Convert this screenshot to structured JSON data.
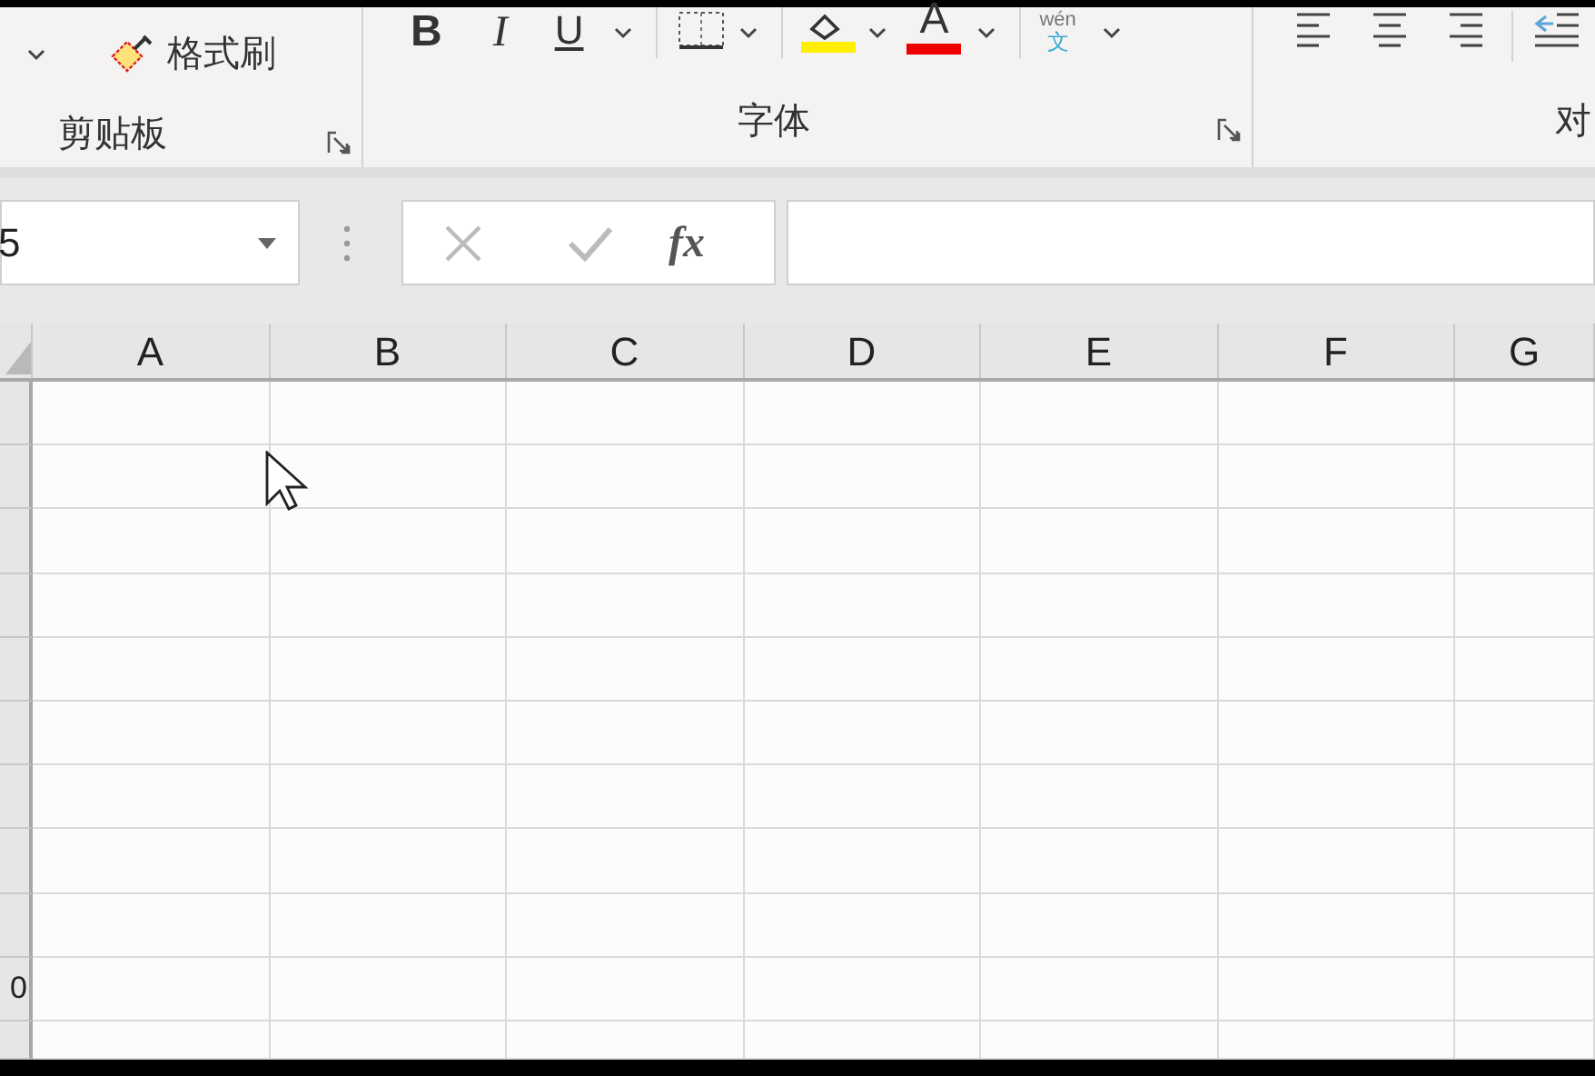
{
  "ribbon": {
    "clipboard": {
      "format_painter": "格式刷",
      "group_label": "剪贴板"
    },
    "font": {
      "bold": "B",
      "italic": "I",
      "underline": "U",
      "font_color": "A",
      "phonetic_top": "wén",
      "phonetic_char": "文",
      "group_label": "字体"
    },
    "alignment": {
      "group_label": "对"
    }
  },
  "formula_bar": {
    "name_box": "5",
    "fx": "fx"
  },
  "grid": {
    "columns": [
      "A",
      "B",
      "C",
      "D",
      "E",
      "F",
      "G"
    ],
    "row_headers": [
      "0"
    ]
  }
}
